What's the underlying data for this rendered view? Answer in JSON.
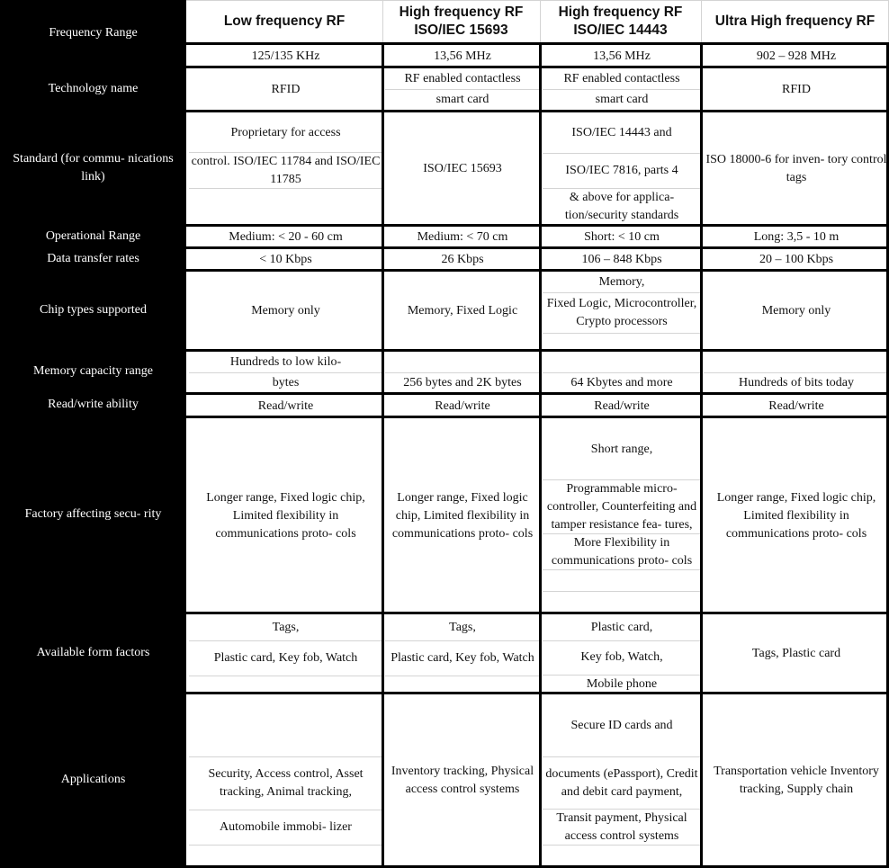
{
  "table": {
    "columns": [
      "Low frequency RF",
      "High frequency RF ISO/IEC 15693",
      "High frequency RF ISO/IEC 14443",
      "Ultra High frequency RF"
    ],
    "header_lines": [
      [
        "Low frequency RF"
      ],
      [
        "High frequency RF",
        "ISO/IEC 15693"
      ],
      [
        "High frequency RF",
        "ISO/IEC 14443"
      ],
      [
        "Ultra High frequency RF"
      ]
    ],
    "row_labels": {
      "frequency_range": "Frequency Range",
      "technology_name": "Technology name",
      "standard": "Standard (for commu- nications link)",
      "operational_range": "Operational Range",
      "data_transfer_rates": "Data transfer rates",
      "chip_types": "Chip types supported",
      "memory_capacity": "Memory capacity range",
      "read_write": "Read/write ability",
      "factory_security": "Factory affecting secu- rity",
      "form_factors": "Available form factors",
      "applications": "Applications"
    },
    "rows": {
      "frequency_range": [
        "125/135 KHz",
        "13,56 MHz",
        "13,56 MHz",
        "902 – 928 MHz"
      ],
      "technology_name": [
        [
          "RFID"
        ],
        [
          "RF enabled contactless",
          "smart card"
        ],
        [
          "RF enabled contactless",
          "smart card"
        ],
        [
          "RFID"
        ]
      ],
      "standard": [
        [
          "Proprietary for access",
          "control. ISO/IEC 11784 and ISO/IEC 11785",
          ""
        ],
        [
          "ISO/IEC 15693"
        ],
        [
          "ISO/IEC 14443 and",
          "ISO/IEC 7816, parts 4",
          "& above for applica- tion/security standards"
        ],
        [
          "ISO 18000-6 for inven- tory control tags"
        ]
      ],
      "operational_range": [
        "Medium: < 20 - 60 cm",
        "Medium: < 70 cm",
        "Short: < 10 cm",
        "Long: 3,5 - 10 m"
      ],
      "data_transfer_rates": [
        "< 10 Kbps",
        "26 Kbps",
        "106 – 848 Kbps",
        "20 – 100 Kbps"
      ],
      "chip_types": [
        [
          "Memory only"
        ],
        [
          "Memory, Fixed Logic"
        ],
        [
          "Memory,",
          "Fixed Logic, Microcontroller, Crypto processors",
          ""
        ],
        [
          "Memory only"
        ]
      ],
      "memory_capacity": [
        [
          "Hundreds to low kilo-",
          "bytes"
        ],
        [
          "",
          "256 bytes and 2K bytes"
        ],
        [
          "",
          "64 Kbytes and more"
        ],
        [
          "",
          "Hundreds of bits today"
        ]
      ],
      "read_write": [
        "Read/write",
        "Read/write",
        "Read/write",
        "Read/write"
      ],
      "factory_security": [
        [
          "Longer range, Fixed logic chip, Limited flexibility in communications proto- cols"
        ],
        [
          "Longer range, Fixed logic chip, Limited flexibility in communications proto- cols"
        ],
        [
          "Short range,",
          "Programmable micro- controller, Counterfeiting and tamper resistance fea- tures,",
          "More Flexibility in communications proto- cols",
          "",
          ""
        ],
        [
          "Longer range, Fixed logic chip, Limited flexibility in communications proto- cols"
        ]
      ],
      "form_factors": [
        [
          "Tags,",
          "Plastic card, Key fob, Watch",
          ""
        ],
        [
          "Tags,",
          "Plastic card, Key fob, Watch",
          ""
        ],
        [
          "Plastic card,",
          "Key fob, Watch,",
          "Mobile phone"
        ],
        [
          "Tags, Plastic card"
        ]
      ],
      "applications": [
        [
          "",
          "Security, Access control, Asset tracking, Animal tracking,",
          "Automobile immobi- lizer",
          ""
        ],
        [
          "Inventory tracking, Physical access control systems"
        ],
        [
          "Secure ID cards and",
          "documents (ePassport), Credit and debit card payment,",
          "Transit payment, Physical access control systems",
          ""
        ],
        [
          "Transportation vehicle Inventory tracking, Supply chain"
        ]
      ]
    }
  }
}
